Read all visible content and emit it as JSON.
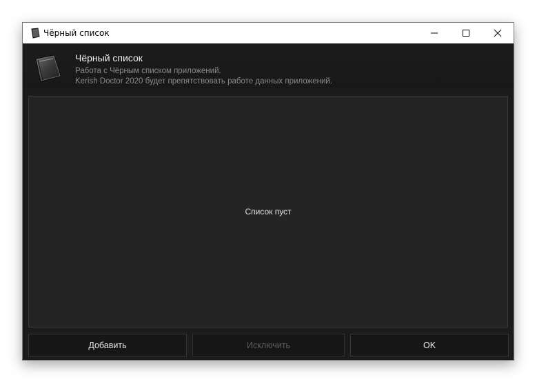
{
  "window": {
    "title": "Чёрный список",
    "icon": "notebook-icon",
    "controls": [
      "minimize-icon",
      "maximize-icon",
      "close-icon"
    ]
  },
  "header": {
    "title": "Чёрный список",
    "description_line1": "Работа с Чёрным списком приложений.",
    "description_line2": "Kerish Doctor 2020 будет препятствовать работе данных приложений.",
    "icon": "notebook-icon"
  },
  "list": {
    "empty_message": "Список пуст"
  },
  "buttons": {
    "add_label": "Добавить",
    "exclude_label": "Исключить",
    "exclude_enabled": false,
    "ok_label": "OK"
  },
  "colors": {
    "window_bg": "#1b1b1b",
    "panel_bg": "#242424",
    "titlebar_bg": "#ffffff"
  }
}
